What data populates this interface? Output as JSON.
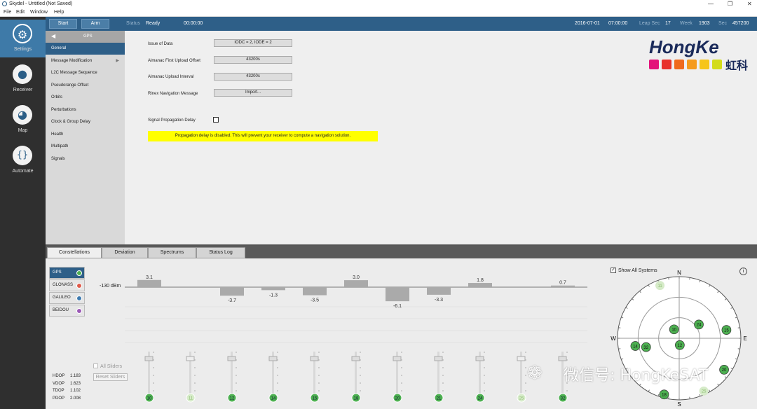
{
  "window": {
    "title": "Skydel - Untitled (Not Saved)",
    "controls": [
      "—",
      "❐",
      "✕"
    ]
  },
  "menu": [
    "File",
    "Edit",
    "Window",
    "Help"
  ],
  "nav": [
    {
      "label": "Settings",
      "icon": "gear-icon",
      "glyph": "⚙"
    },
    {
      "label": "Receiver",
      "icon": "location-pin-icon",
      "glyph": "●"
    },
    {
      "label": "Map",
      "icon": "globe-icon",
      "glyph": "◕"
    },
    {
      "label": "Automate",
      "icon": "braces-icon",
      "glyph": "{}"
    }
  ],
  "toolbar": {
    "start": "Start",
    "arm": "Arm",
    "status_label": "Status",
    "status_value": "Ready",
    "elapsed": "00:00:00",
    "date": "2016-07-01",
    "time": "07:00:00",
    "leap_label": "Leap Sec",
    "leap_value": "17",
    "week_label": "Week",
    "week_value": "1903",
    "sec_label": "Sec",
    "sec_value": "457200"
  },
  "sidebar": {
    "header": "GPS",
    "items": [
      {
        "label": "General",
        "selected": true,
        "arrow": false
      },
      {
        "label": "Message Modification",
        "selected": false,
        "arrow": true
      },
      {
        "label": "L2C Message Sequence",
        "selected": false,
        "arrow": false
      },
      {
        "label": "Pseudorange Offset",
        "selected": false,
        "arrow": false
      },
      {
        "label": "Orbits",
        "selected": false,
        "arrow": false
      },
      {
        "label": "Perturbations",
        "selected": false,
        "arrow": false
      },
      {
        "label": "Clock & Group Delay",
        "selected": false,
        "arrow": false
      },
      {
        "label": "Health",
        "selected": false,
        "arrow": false
      },
      {
        "label": "Multipath",
        "selected": false,
        "arrow": false
      },
      {
        "label": "Signals",
        "selected": false,
        "arrow": false
      }
    ]
  },
  "general": {
    "iod_label": "Issue of Data",
    "iod_value": "IODC = 2, IODE = 2",
    "alm_offset_label": "Almanac First Upload Offset",
    "alm_offset_value": "43200s",
    "alm_interval_label": "Almanac Upload Interval",
    "alm_interval_value": "43200s",
    "rinex_label": "Rinex Navigation Message",
    "rinex_button": "Import...",
    "propdelay_label": "Signal Propagation Delay",
    "warning": "Propagation delay is disabled. This will prevent your receiver to compute a navigation solution."
  },
  "logo": {
    "text": "HongKe",
    "cn": "虹科",
    "colors": [
      "#e3127a",
      "#e8322b",
      "#ef6a1c",
      "#f59b1c",
      "#f6c51a",
      "#d3dc1a"
    ]
  },
  "tabs": [
    {
      "label": "Constellations",
      "selected": true
    },
    {
      "label": "Deviation",
      "selected": false
    },
    {
      "label": "Spectrums",
      "selected": false
    },
    {
      "label": "Status Log",
      "selected": false
    }
  ],
  "constellations": [
    {
      "label": "GPS",
      "color": "#4caf50",
      "selected": true
    },
    {
      "label": "GLONASS",
      "color": "#e05a4a",
      "selected": false
    },
    {
      "label": "GALILEO",
      "color": "#3e7ab0",
      "selected": false
    },
    {
      "label": "BEIDOU",
      "color": "#9b59b6",
      "selected": false
    }
  ],
  "dop": [
    {
      "label": "HDOP",
      "value": "1.183"
    },
    {
      "label": "VDOP",
      "value": "1.623"
    },
    {
      "label": "TDOP",
      "value": "1.102"
    },
    {
      "label": "PDOP",
      "value": "2.008"
    }
  ],
  "sliders": {
    "all_label": "All Sliders",
    "reset_label": "Reset Sliders"
  },
  "chart_data": {
    "type": "bar",
    "reference_label": "-130 dBm",
    "categories": [
      "10",
      "11",
      "12",
      "14",
      "15",
      "18",
      "20",
      "21",
      "24",
      "25",
      "32"
    ],
    "values": [
      3.1,
      null,
      -3.7,
      -1.3,
      -3.5,
      3.0,
      -6.1,
      -3.3,
      1.8,
      null,
      0.7
    ],
    "labels": [
      "3.1",
      "",
      "-3.7",
      "-1.3",
      "-3.5",
      "3.0",
      "-6.1",
      "-3.3",
      "1.8",
      "",
      "0.7"
    ],
    "faded": [
      false,
      true,
      false,
      false,
      false,
      false,
      false,
      false,
      false,
      true,
      false
    ],
    "ylim": [
      -8,
      5
    ]
  },
  "skyplot": {
    "show_all_label": "Show All Systems",
    "info_glyph": "i",
    "north": "N",
    "south": "S",
    "east": "E",
    "west": "W",
    "satellites": [
      {
        "prn": "11",
        "az": -20,
        "el": 8,
        "faded": true
      },
      {
        "prn": "10",
        "az": -30,
        "el": 75,
        "faded": false
      },
      {
        "prn": "32",
        "az": -105,
        "el": 40,
        "faded": false
      },
      {
        "prn": "14",
        "az": -100,
        "el": 25,
        "faded": false
      },
      {
        "prn": "12",
        "az": 175,
        "el": 80,
        "faded": false
      },
      {
        "prn": "24",
        "az": 55,
        "el": 55,
        "faded": false
      },
      {
        "prn": "15",
        "az": 80,
        "el": 20,
        "faded": false
      },
      {
        "prn": "20",
        "az": 125,
        "el": 10,
        "faded": false
      },
      {
        "prn": "18",
        "az": 195,
        "el": 5,
        "faded": false
      },
      {
        "prn": "25",
        "az": 155,
        "el": 5,
        "faded": true
      }
    ]
  },
  "watermark": "微信号: HongKeSAT"
}
